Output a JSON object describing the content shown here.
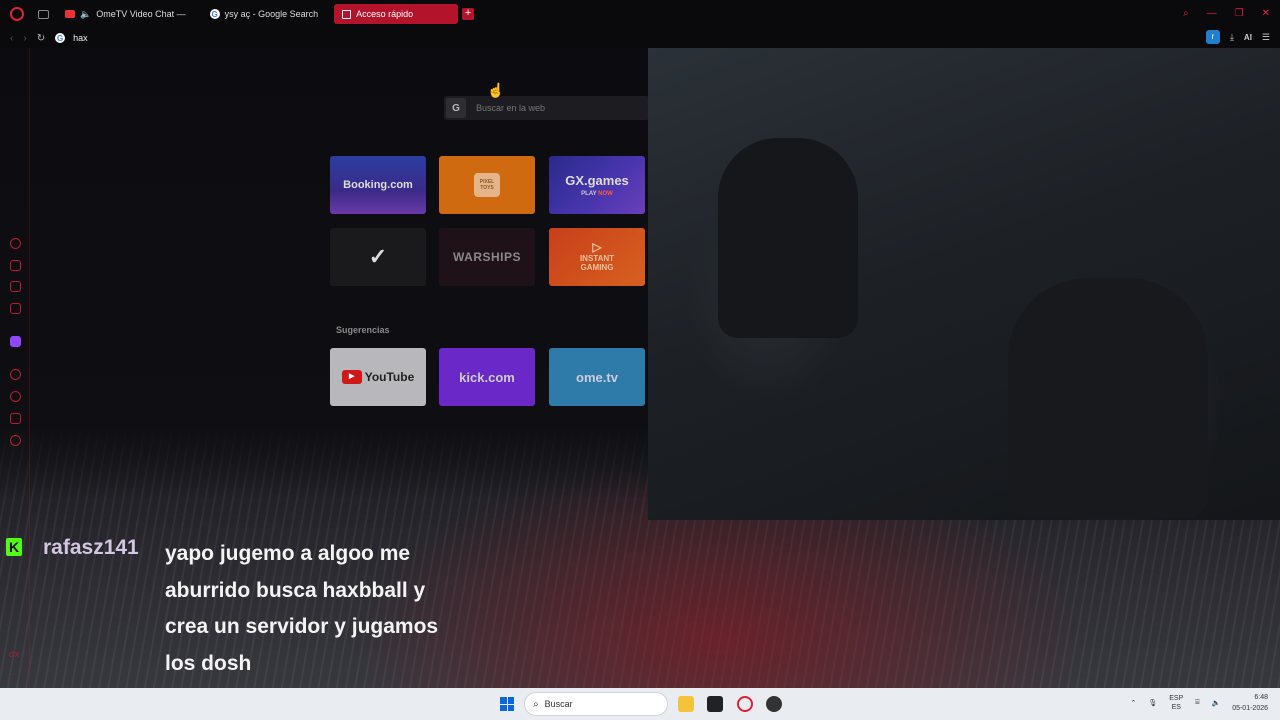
{
  "browser": {
    "tabs": [
      {
        "label": "OmeTV Video Chat —",
        "favicon": "ometv-icon",
        "audio": true
      },
      {
        "label": "ysy aç - Google Search",
        "favicon": "google-icon"
      },
      {
        "label": "Acceso rápido",
        "favicon": "speed-dial-icon",
        "active": true
      }
    ],
    "new_tab": "+",
    "address": {
      "value": "hax",
      "engine_icon": "G"
    },
    "toolbar_right": {
      "ext_badge": "r",
      "ai_label": "AI"
    },
    "accent": "#b3142c"
  },
  "speed_dial": {
    "search": {
      "engine": "G",
      "placeholder": "Buscar en la web"
    },
    "tiles": [
      {
        "label": "Booking.com"
      },
      {
        "label": "PIXEL TOYS"
      },
      {
        "label": "GX.games",
        "sub_a": "PLAY",
        "sub_b": "NOW"
      },
      {
        "label": "✓",
        "name": "nike"
      },
      {
        "label": "WARSHIPS"
      },
      {
        "label_a": "INSTANT",
        "label_b": "GAMING"
      }
    ],
    "suggestions_title": "Sugerencias",
    "suggestions": [
      {
        "label": "YouTube"
      },
      {
        "label": "kick.com"
      },
      {
        "label": "ome.tv"
      }
    ]
  },
  "sidebar": {
    "gx_label": "GX",
    "more": "..."
  },
  "chat": {
    "badge": "K",
    "username": "rafasz141",
    "message": "yapo jugemo a algoo me aburrido busca haxbball y crea un servidor y jugamos los dosh",
    "badge_color": "#53fc18"
  },
  "taskbar": {
    "search_placeholder": "Buscar",
    "lang_top": "ESP",
    "lang_bottom": "ES",
    "time": "6:48",
    "date": "05-01-2026"
  }
}
